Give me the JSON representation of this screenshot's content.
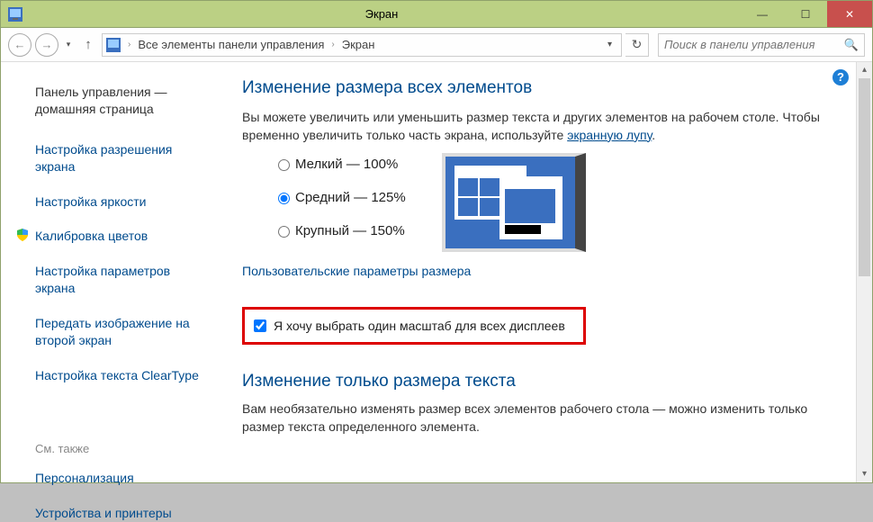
{
  "window": {
    "title": "Экран"
  },
  "winbuttons": {
    "min": "—",
    "max": "☐",
    "close": "✕"
  },
  "nav": {
    "back": "←",
    "fwd": "→",
    "dd": "▾",
    "up": "↑",
    "crumb1": "Все элементы панели управления",
    "crumb2": "Экран",
    "sep": "›",
    "refresh": "↻",
    "search_placeholder": "Поиск в панели управления",
    "search_icon": "🔍"
  },
  "sidebar": {
    "home_l1": "Панель управления —",
    "home_l2": "домашняя страница",
    "l1a": "Настройка разрешения",
    "l1b": "экрана",
    "l2": "Настройка яркости",
    "l3": "Калибровка цветов",
    "l4a": "Настройка параметров",
    "l4b": "экрана",
    "l5a": "Передать изображение на",
    "l5b": "второй экран",
    "l6": "Настройка текста ClearType",
    "seealso": "См. также",
    "s1": "Персонализация",
    "s2": "Устройства и принтеры"
  },
  "main": {
    "h1": "Изменение размера всех элементов",
    "intro": "Вы можете увеличить или уменьшить размер текста и других элементов на рабочем столе. Чтобы временно увеличить только часть экрана, используйте ",
    "intro_link": "экранную лупу",
    "dot": ".",
    "r1": "Мелкий — 100%",
    "r2": "Средний — 125%",
    "r3": "Крупный — 150%",
    "custom": "Пользовательские параметры размера",
    "checkbox": "Я хочу выбрать один масштаб для всех дисплеев",
    "h2": "Изменение только размера текста",
    "p2": "Вам необязательно изменять размер всех элементов рабочего стола — можно изменить только размер текста определенного элемента."
  },
  "help": "?"
}
